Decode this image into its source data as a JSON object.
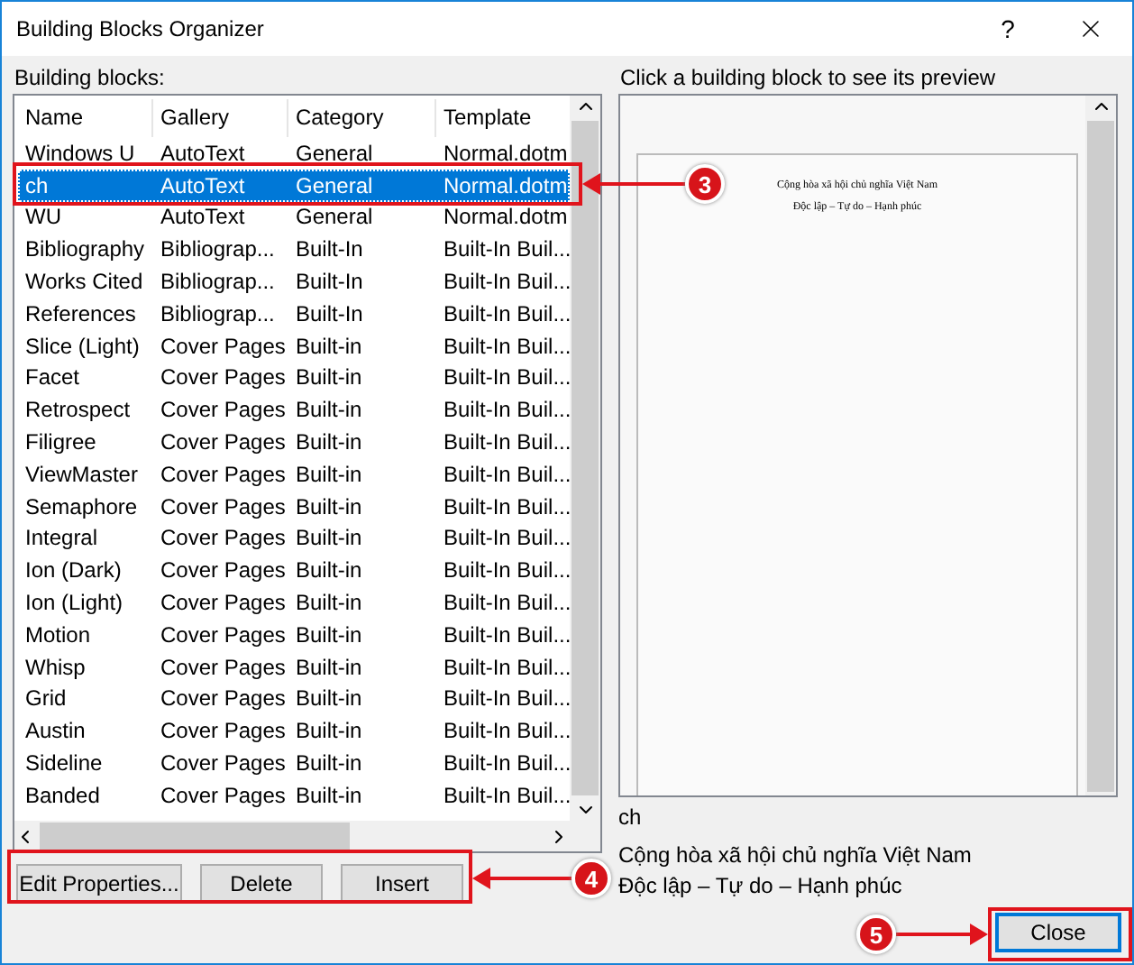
{
  "window": {
    "title": "Building Blocks Organizer",
    "help": "?"
  },
  "list": {
    "label": "Building blocks:",
    "columns": [
      "Name",
      "Gallery",
      "Category",
      "Template"
    ],
    "rows": [
      {
        "cells": [
          "Windows U",
          "AutoText",
          "General",
          "Normal.dotm"
        ],
        "selected": false
      },
      {
        "cells": [
          "ch",
          "AutoText",
          "General",
          "Normal.dotm"
        ],
        "selected": true
      },
      {
        "cells": [
          "WU",
          "AutoText",
          "General",
          "Normal.dotm"
        ],
        "selected": false
      },
      {
        "cells": [
          "Bibliography",
          "Bibliograp...",
          "Built-In",
          "Built-In Buil..."
        ],
        "selected": false
      },
      {
        "cells": [
          "Works Cited",
          "Bibliograp...",
          "Built-In",
          "Built-In Buil..."
        ],
        "selected": false
      },
      {
        "cells": [
          "References",
          "Bibliograp...",
          "Built-In",
          "Built-In Buil..."
        ],
        "selected": false
      },
      {
        "cells": [
          "Slice (Light)",
          "Cover Pages",
          "Built-in",
          "Built-In Buil..."
        ],
        "selected": false
      },
      {
        "cells": [
          "Facet",
          "Cover Pages",
          "Built-in",
          "Built-In Buil..."
        ],
        "selected": false
      },
      {
        "cells": [
          "Retrospect",
          "Cover Pages",
          "Built-in",
          "Built-In Buil..."
        ],
        "selected": false
      },
      {
        "cells": [
          "Filigree",
          "Cover Pages",
          "Built-in",
          "Built-In Buil..."
        ],
        "selected": false
      },
      {
        "cells": [
          "ViewMaster",
          "Cover Pages",
          "Built-in",
          "Built-In Buil..."
        ],
        "selected": false
      },
      {
        "cells": [
          "Semaphore",
          "Cover Pages",
          "Built-in",
          "Built-In Buil..."
        ],
        "selected": false
      },
      {
        "cells": [
          "Integral",
          "Cover Pages",
          "Built-in",
          "Built-In Buil..."
        ],
        "selected": false
      },
      {
        "cells": [
          "Ion (Dark)",
          "Cover Pages",
          "Built-in",
          "Built-In Buil..."
        ],
        "selected": false
      },
      {
        "cells": [
          "Ion (Light)",
          "Cover Pages",
          "Built-in",
          "Built-In Buil..."
        ],
        "selected": false
      },
      {
        "cells": [
          "Motion",
          "Cover Pages",
          "Built-in",
          "Built-In Buil..."
        ],
        "selected": false
      },
      {
        "cells": [
          "Whisp",
          "Cover Pages",
          "Built-in",
          "Built-In Buil..."
        ],
        "selected": false
      },
      {
        "cells": [
          "Grid",
          "Cover Pages",
          "Built-in",
          "Built-In Buil..."
        ],
        "selected": false
      },
      {
        "cells": [
          "Austin",
          "Cover Pages",
          "Built-in",
          "Built-In Buil..."
        ],
        "selected": false
      },
      {
        "cells": [
          "Sideline",
          "Cover Pages",
          "Built-in",
          "Built-In Buil..."
        ],
        "selected": false
      },
      {
        "cells": [
          "Banded",
          "Cover Pages",
          "Built-in",
          "Built-In Buil..."
        ],
        "selected": false
      }
    ]
  },
  "buttons": [
    "Edit Properties...",
    "Delete",
    "Insert"
  ],
  "preview": {
    "label": "Click a building block to see its preview",
    "page_lines": [
      "Cộng hòa xã hội chủ nghĩa Việt Nam",
      "Độc lập – Tự do – Hạnh phúc"
    ],
    "name": "ch",
    "description": [
      "Cộng hòa xã hội chủ nghĩa Việt Nam",
      "Độc lập – Tự do – Hạnh phúc"
    ]
  },
  "close_button": "Close",
  "annotations": [
    {
      "label": "3"
    },
    {
      "label": "4"
    },
    {
      "label": "5"
    }
  ]
}
